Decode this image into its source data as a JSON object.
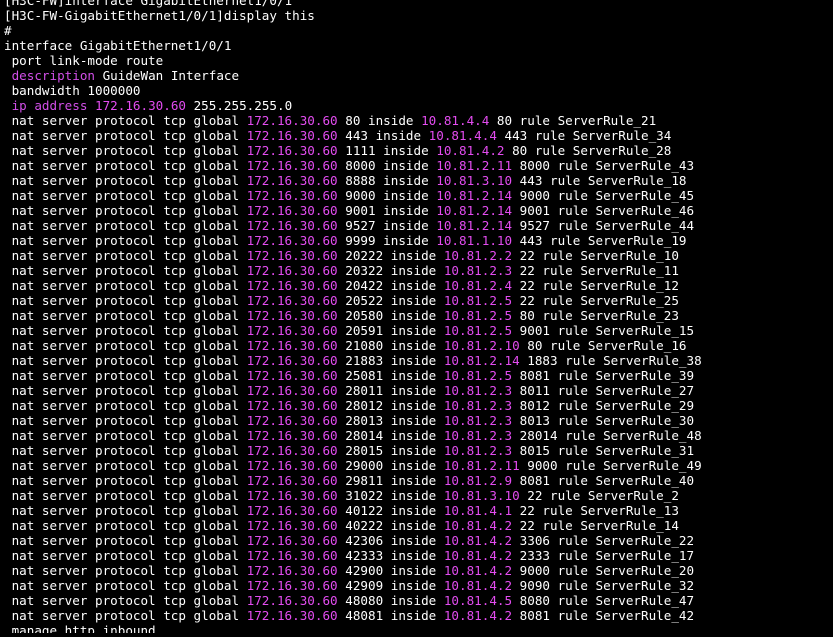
{
  "colors": {
    "background": "#000000",
    "text": "#ffffff",
    "highlight": "#e34cf0"
  },
  "terminal": {
    "partial_line": "[H3C-FW]interface GigabitEthernet1/0/1",
    "prompt_line": "[H3C-FW-GigabitEthernet1/0/1]display this",
    "hash": "#",
    "interface_line": "interface GigabitEthernet1/0/1",
    "port_line": " port link-mode route",
    "description_keyword": " description",
    "description_value": " GuideWan Interface",
    "bandwidth_line": " bandwidth 1000000",
    "ip_keyword": " ip address",
    "ip_value": "172.16.30.60",
    "ip_mask": " 255.255.255.0",
    "nat_prefix": " nat server protocol tcp global ",
    "global_ip": "172.16.30.60",
    "nat_rules": [
      {
        "port": "80",
        "inside_ip": "10.81.4.4",
        "inside_port": "80",
        "rule": "ServerRule_21"
      },
      {
        "port": "443",
        "inside_ip": "10.81.4.4",
        "inside_port": "443",
        "rule": "ServerRule_34"
      },
      {
        "port": "1111",
        "inside_ip": "10.81.4.2",
        "inside_port": "80",
        "rule": "ServerRule_28"
      },
      {
        "port": "8000",
        "inside_ip": "10.81.2.11",
        "inside_port": "8000",
        "rule": "ServerRule_43"
      },
      {
        "port": "8888",
        "inside_ip": "10.81.3.10",
        "inside_port": "443",
        "rule": "ServerRule_18"
      },
      {
        "port": "9000",
        "inside_ip": "10.81.2.14",
        "inside_port": "9000",
        "rule": "ServerRule_45"
      },
      {
        "port": "9001",
        "inside_ip": "10.81.2.14",
        "inside_port": "9001",
        "rule": "ServerRule_46"
      },
      {
        "port": "9527",
        "inside_ip": "10.81.2.14",
        "inside_port": "9527",
        "rule": "ServerRule_44"
      },
      {
        "port": "9999",
        "inside_ip": "10.81.1.10",
        "inside_port": "443",
        "rule": "ServerRule_19"
      },
      {
        "port": "20222",
        "inside_ip": "10.81.2.2",
        "inside_port": "22",
        "rule": "ServerRule_10"
      },
      {
        "port": "20322",
        "inside_ip": "10.81.2.3",
        "inside_port": "22",
        "rule": "ServerRule_11"
      },
      {
        "port": "20422",
        "inside_ip": "10.81.2.4",
        "inside_port": "22",
        "rule": "ServerRule_12"
      },
      {
        "port": "20522",
        "inside_ip": "10.81.2.5",
        "inside_port": "22",
        "rule": "ServerRule_25"
      },
      {
        "port": "20580",
        "inside_ip": "10.81.2.5",
        "inside_port": "80",
        "rule": "ServerRule_23"
      },
      {
        "port": "20591",
        "inside_ip": "10.81.2.5",
        "inside_port": "9001",
        "rule": "ServerRule_15"
      },
      {
        "port": "21080",
        "inside_ip": "10.81.2.10",
        "inside_port": "80",
        "rule": "ServerRule_16"
      },
      {
        "port": "21883",
        "inside_ip": "10.81.2.14",
        "inside_port": "1883",
        "rule": "ServerRule_38"
      },
      {
        "port": "25081",
        "inside_ip": "10.81.2.5",
        "inside_port": "8081",
        "rule": "ServerRule_39"
      },
      {
        "port": "28011",
        "inside_ip": "10.81.2.3",
        "inside_port": "8011",
        "rule": "ServerRule_27"
      },
      {
        "port": "28012",
        "inside_ip": "10.81.2.3",
        "inside_port": "8012",
        "rule": "ServerRule_29"
      },
      {
        "port": "28013",
        "inside_ip": "10.81.2.3",
        "inside_port": "8013",
        "rule": "ServerRule_30"
      },
      {
        "port": "28014",
        "inside_ip": "10.81.2.3",
        "inside_port": "28014",
        "rule": "ServerRule_48"
      },
      {
        "port": "28015",
        "inside_ip": "10.81.2.3",
        "inside_port": "8015",
        "rule": "ServerRule_31"
      },
      {
        "port": "29000",
        "inside_ip": "10.81.2.11",
        "inside_port": "9000",
        "rule": "ServerRule_49"
      },
      {
        "port": "29811",
        "inside_ip": "10.81.2.9",
        "inside_port": "8081",
        "rule": "ServerRule_40"
      },
      {
        "port": "31022",
        "inside_ip": "10.81.3.10",
        "inside_port": "22",
        "rule": "ServerRule_2"
      },
      {
        "port": "40122",
        "inside_ip": "10.81.4.1",
        "inside_port": "22",
        "rule": "ServerRule_13"
      },
      {
        "port": "40222",
        "inside_ip": "10.81.4.2",
        "inside_port": "22",
        "rule": "ServerRule_14"
      },
      {
        "port": "42306",
        "inside_ip": "10.81.4.2",
        "inside_port": "3306",
        "rule": "ServerRule_22"
      },
      {
        "port": "42333",
        "inside_ip": "10.81.4.2",
        "inside_port": "2333",
        "rule": "ServerRule_17"
      },
      {
        "port": "42900",
        "inside_ip": "10.81.4.2",
        "inside_port": "9000",
        "rule": "ServerRule_20"
      },
      {
        "port": "42909",
        "inside_ip": "10.81.4.2",
        "inside_port": "9090",
        "rule": "ServerRule_32"
      },
      {
        "port": "48080",
        "inside_ip": "10.81.4.5",
        "inside_port": "8080",
        "rule": "ServerRule_47"
      },
      {
        "port": "48081",
        "inside_ip": "10.81.4.2",
        "inside_port": "8081",
        "rule": "ServerRule_42"
      }
    ],
    "last_line": " manage http inbound"
  }
}
